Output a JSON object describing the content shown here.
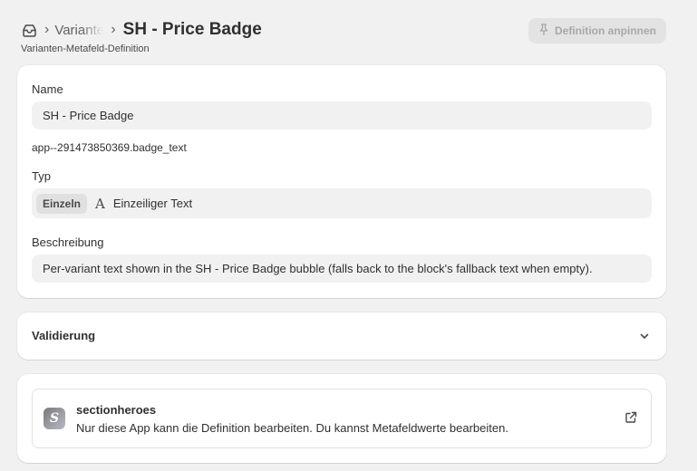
{
  "header": {
    "breadcrumb_parent": "Varianten",
    "title": "SH - Price Badge",
    "subtitle": "Varianten-Metafeld-Definition",
    "pin_button_label": "Definition anpinnen"
  },
  "definition": {
    "name_label": "Name",
    "name_value": "SH - Price Badge",
    "key": "app--291473850369.badge_text",
    "type_label": "Typ",
    "type_tag": "Einzeln",
    "type_icon": "A",
    "type_value": "Einzeiliger Text",
    "description_label": "Beschreibung",
    "description_value": "Per-variant text shown in the SH - Price Badge bubble (falls back to the block's fallback text when empty)."
  },
  "validation": {
    "title": "Validierung"
  },
  "app": {
    "logo_letter": "S",
    "name": "sectionheroes",
    "description": "Nur diese App kann die Definition bearbeiten. Du kannst Metafeldwerte bearbeiten."
  }
}
